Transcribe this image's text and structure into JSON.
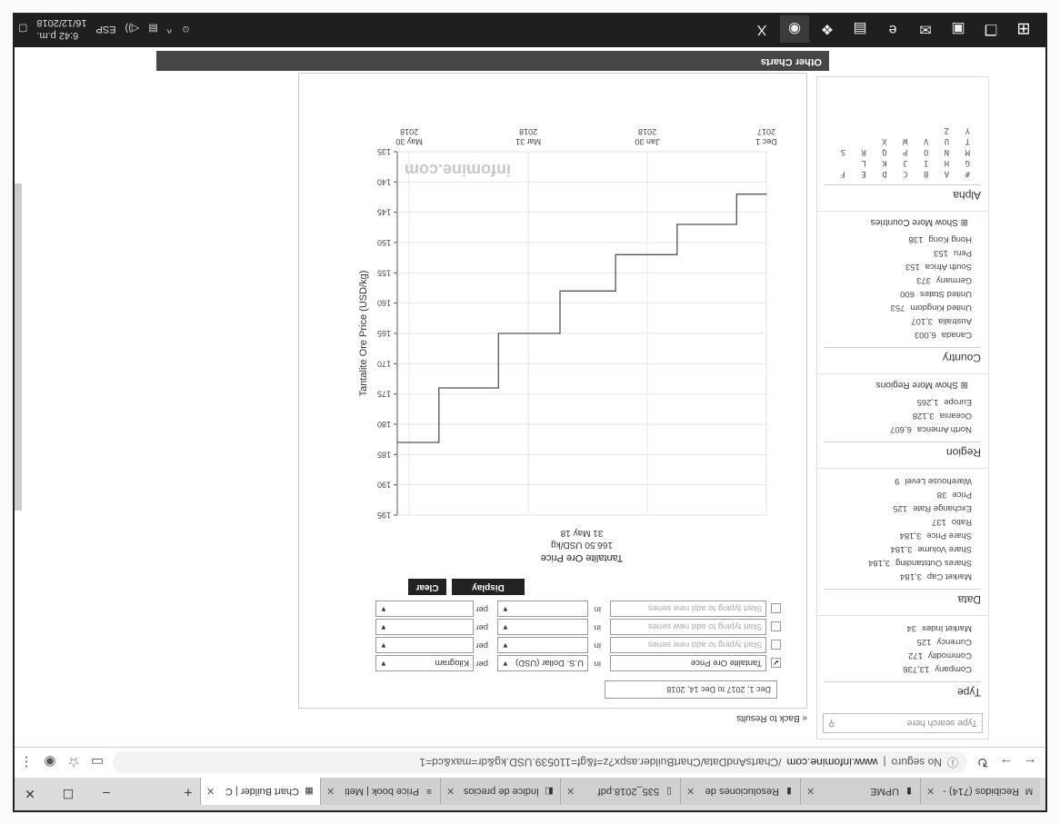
{
  "browser": {
    "tabs": [
      {
        "icon": "gmail-icon",
        "label": "Recibidos (714) -"
      },
      {
        "icon": "file-icon",
        "label": "UPME"
      },
      {
        "icon": "file-icon",
        "label": "Resoluciones de"
      },
      {
        "icon": "pdf-icon",
        "label": "535_2018.pdf"
      },
      {
        "icon": "doc-icon",
        "label": "Índice de precios"
      },
      {
        "icon": "bars-icon",
        "label": "Price book | Meti"
      },
      {
        "icon": "chart-icon",
        "label": "Chart Builder | C"
      }
    ],
    "new_tab": "+",
    "security": "No seguro",
    "url_host": "www.infomine.com",
    "url_path": "/ChartsAndData/ChartBuilder.aspx?z=f&gf=110539.USD.kg&dr=max&cd=1"
  },
  "sidebar": {
    "search_placeholder": "Type search here",
    "type": {
      "title": "Type",
      "items": [
        {
          "name": "Company",
          "count": "13,736"
        },
        {
          "name": "Commodity",
          "count": "172"
        },
        {
          "name": "Currency",
          "count": "125"
        },
        {
          "name": "Market Index",
          "count": "34"
        }
      ]
    },
    "data": {
      "title": "Data",
      "items": [
        {
          "name": "Market Cap",
          "count": "3,184"
        },
        {
          "name": "Shares Outstanding",
          "count": "3,184"
        },
        {
          "name": "Share Volume",
          "count": "3,184"
        },
        {
          "name": "Share Price",
          "count": "3,184"
        },
        {
          "name": "Ratio",
          "count": "137"
        },
        {
          "name": "Exchange Rate",
          "count": "125"
        },
        {
          "name": "Price",
          "count": "38"
        },
        {
          "name": "Warehouse Level",
          "count": "9"
        }
      ]
    },
    "region": {
      "title": "Region",
      "items": [
        {
          "name": "North America",
          "count": "6,607"
        },
        {
          "name": "Oceania",
          "count": "3,128"
        },
        {
          "name": "Europe",
          "count": "1,265"
        }
      ],
      "more": "Show More Regions"
    },
    "country": {
      "title": "Country",
      "items": [
        {
          "name": "Canada",
          "count": "6,003"
        },
        {
          "name": "Australia",
          "count": "3,107"
        },
        {
          "name": "United Kingdom",
          "count": "753"
        },
        {
          "name": "United States",
          "count": "600"
        },
        {
          "name": "Germany",
          "count": "373"
        },
        {
          "name": "South Africa",
          "count": "153"
        },
        {
          "name": "Peru",
          "count": "153"
        },
        {
          "name": "Hong Kong",
          "count": "138"
        }
      ],
      "more": "Show More Countries"
    },
    "alpha": {
      "title": "Alpha",
      "lines": [
        "# A B C D E F G H I J K L",
        "M N O P Q R S T U V W X",
        "Y Z"
      ]
    }
  },
  "main": {
    "back_link": "« Back to Results",
    "date_range": "Dec 1, 2017 to Dec 14, 2018",
    "series": [
      {
        "checked": true,
        "name": "Tantalite Ore Price",
        "in": "in",
        "unit": "U.S. Dollar (USD)",
        "per": "per",
        "per_unit": "Kilogram"
      },
      {
        "checked": false,
        "name": "Start typing to add new series",
        "in": "in",
        "unit": "",
        "per": "per",
        "per_unit": ""
      },
      {
        "checked": false,
        "name": "Start typing to add new series",
        "in": "in",
        "unit": "",
        "per": "per",
        "per_unit": ""
      },
      {
        "checked": false,
        "name": "Start typing to add new series",
        "in": "in",
        "unit": "",
        "per": "per",
        "per_unit": ""
      }
    ],
    "display_button": "Display",
    "clear_button": "Clear",
    "other_charts": "Other Charts"
  },
  "chart_data": {
    "type": "line",
    "title": "Tantalite Ore Price",
    "current_value": "166.50 USD/kg",
    "current_date": "31 May 18",
    "ylabel": "Tantalite Ore Price (USD/kg)",
    "watermark": "infomine.com",
    "ylim": [
      135,
      195
    ],
    "yticks": [
      135,
      140,
      145,
      150,
      155,
      160,
      165,
      170,
      175,
      180,
      185,
      190,
      195
    ],
    "xticks": [
      {
        "date": "2017-12-01",
        "line1": "Dec 1",
        "line2": "2017"
      },
      {
        "date": "2018-01-30",
        "line1": "Jan 30",
        "line2": "2018"
      },
      {
        "date": "2018-03-31",
        "line1": "Mar 31",
        "line2": "2018"
      },
      {
        "date": "2018-05-30",
        "line1": "May 30",
        "line2": "2018"
      }
    ],
    "x_range": [
      "2017-12-01",
      "2018-06-05"
    ],
    "series": [
      {
        "name": "Tantalite Ore Price",
        "step": true,
        "points": [
          {
            "x": "2017-12-01",
            "y": 142
          },
          {
            "x": "2017-12-16",
            "y": 142
          },
          {
            "x": "2017-12-16",
            "y": 147
          },
          {
            "x": "2018-01-15",
            "y": 147
          },
          {
            "x": "2018-01-15",
            "y": 152
          },
          {
            "x": "2018-02-15",
            "y": 152
          },
          {
            "x": "2018-02-15",
            "y": 158
          },
          {
            "x": "2018-03-15",
            "y": 158
          },
          {
            "x": "2018-03-15",
            "y": 165
          },
          {
            "x": "2018-04-15",
            "y": 165
          },
          {
            "x": "2018-04-15",
            "y": 174
          },
          {
            "x": "2018-05-15",
            "y": 174
          },
          {
            "x": "2018-05-15",
            "y": 183
          },
          {
            "x": "2018-06-05",
            "y": 183
          }
        ]
      }
    ],
    "line_color": "#555555"
  },
  "taskbar": {
    "apps": [
      "start-icon",
      "task-view-icon",
      "files-icon",
      "mail-icon",
      "edge-icon",
      "store-icon",
      "dropbox-icon",
      "chrome-icon",
      "excel-icon"
    ],
    "language": "ESP",
    "time": "6:42 p.m.",
    "date": "16/12/2018"
  }
}
